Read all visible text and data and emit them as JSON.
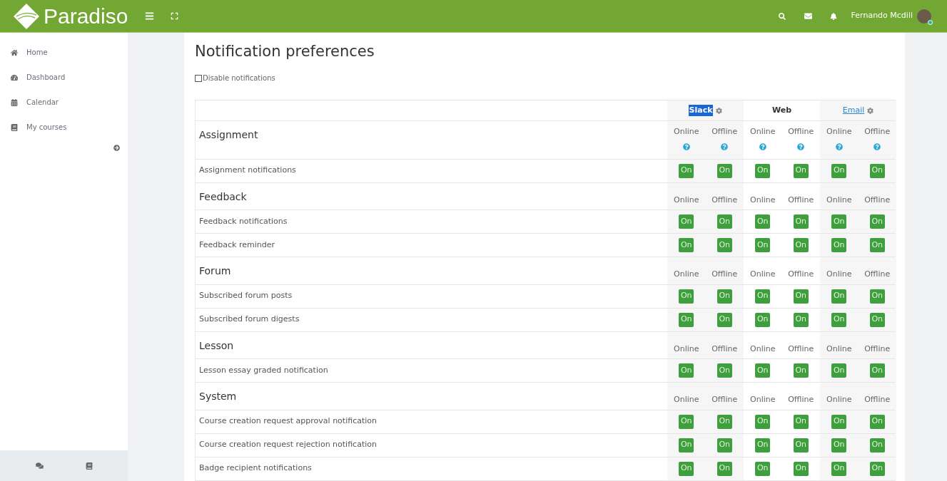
{
  "header": {
    "brand": "Paradiso",
    "user_name": "Fernando Mcdill"
  },
  "sidebar": {
    "items": [
      {
        "label": "Home",
        "selected": false
      },
      {
        "label": "Dashboard",
        "selected": false
      },
      {
        "label": "Calendar",
        "selected": false
      },
      {
        "label": "My courses",
        "selected": false
      }
    ]
  },
  "page": {
    "title": "Notification preferences",
    "disable_notifications": {
      "label": "Disable notifications",
      "checked": false
    }
  },
  "processors": [
    {
      "label": "Slack",
      "kind": "highlighted",
      "settings": true
    },
    {
      "label": "Web",
      "kind": "bold",
      "settings": false
    },
    {
      "label": "Email",
      "kind": "link",
      "settings": true
    }
  ],
  "sections": [
    {
      "title": "Assignment",
      "help": true,
      "states": [
        "Online",
        "Offline",
        "Online",
        "Offline",
        "Online",
        "Offline"
      ],
      "items": [
        {
          "label": "Assignment notifications",
          "toggles": [
            {
              "text": "On",
              "on": true
            },
            {
              "text": "On",
              "on": true
            },
            {
              "text": "On",
              "on": true
            },
            {
              "text": "On",
              "on": true
            },
            {
              "text": "On",
              "on": true
            },
            {
              "text": "On",
              "on": true
            }
          ]
        }
      ]
    },
    {
      "title": "Feedback",
      "help": false,
      "states": [
        "Online",
        "Offline",
        "Online",
        "Offline",
        "Online",
        "Offline"
      ],
      "items": [
        {
          "label": "Feedback notifications",
          "toggles": [
            {
              "text": "On",
              "on": true
            },
            {
              "text": "On",
              "on": true
            },
            {
              "text": "On",
              "on": true
            },
            {
              "text": "On",
              "on": true
            },
            {
              "text": "On",
              "on": true
            },
            {
              "text": "On",
              "on": true
            }
          ]
        },
        {
          "label": "Feedback reminder",
          "toggles": [
            {
              "text": "On",
              "on": true
            },
            {
              "text": "On",
              "on": true
            },
            {
              "text": "On",
              "on": true
            },
            {
              "text": "On",
              "on": true
            },
            {
              "text": "On",
              "on": true
            },
            {
              "text": "On",
              "on": true
            }
          ]
        }
      ]
    },
    {
      "title": "Forum",
      "help": false,
      "states": [
        "Online",
        "Offline",
        "Online",
        "Offline",
        "Online",
        "Offline"
      ],
      "items": [
        {
          "label": "Subscribed forum posts",
          "toggles": [
            {
              "text": "On",
              "on": true
            },
            {
              "text": "On",
              "on": true
            },
            {
              "text": "On",
              "on": true
            },
            {
              "text": "On",
              "on": true
            },
            {
              "text": "On",
              "on": true
            },
            {
              "text": "On",
              "on": true
            }
          ]
        },
        {
          "label": "Subscribed forum digests",
          "toggles": [
            {
              "text": "On",
              "on": true
            },
            {
              "text": "On",
              "on": true
            },
            {
              "text": "On",
              "on": true
            },
            {
              "text": "On",
              "on": true
            },
            {
              "text": "On",
              "on": true
            },
            {
              "text": "On",
              "on": true
            }
          ]
        }
      ]
    },
    {
      "title": "Lesson",
      "help": false,
      "states": [
        "Online",
        "Offline",
        "Online",
        "Offline",
        "Online",
        "Offline"
      ],
      "items": [
        {
          "label": "Lesson essay graded notification",
          "toggles": [
            {
              "text": "On",
              "on": true
            },
            {
              "text": "On",
              "on": true
            },
            {
              "text": "On",
              "on": true
            },
            {
              "text": "On",
              "on": true
            },
            {
              "text": "On",
              "on": true
            },
            {
              "text": "On",
              "on": true
            }
          ]
        }
      ]
    },
    {
      "title": "System",
      "help": false,
      "states": [
        "Online",
        "Offline",
        "Online",
        "Offline",
        "Online",
        "Offline"
      ],
      "items": [
        {
          "label": "Course creation request approval notification",
          "toggles": [
            {
              "text": "On",
              "on": true
            },
            {
              "text": "On",
              "on": true
            },
            {
              "text": "On",
              "on": true
            },
            {
              "text": "On",
              "on": true
            },
            {
              "text": "On",
              "on": true
            },
            {
              "text": "On",
              "on": true
            }
          ]
        },
        {
          "label": "Course creation request rejection notification",
          "toggles": [
            {
              "text": "On",
              "on": true
            },
            {
              "text": "On",
              "on": true
            },
            {
              "text": "On",
              "on": true
            },
            {
              "text": "On",
              "on": true
            },
            {
              "text": "On",
              "on": true
            },
            {
              "text": "On",
              "on": true
            }
          ]
        },
        {
          "label": "Badge recipient notifications",
          "toggles": [
            {
              "text": "On",
              "on": true
            },
            {
              "text": "On",
              "on": true
            },
            {
              "text": "On",
              "on": true
            },
            {
              "text": "On",
              "on": true
            },
            {
              "text": "On",
              "on": true
            },
            {
              "text": "On",
              "on": true
            }
          ]
        }
      ]
    }
  ]
}
